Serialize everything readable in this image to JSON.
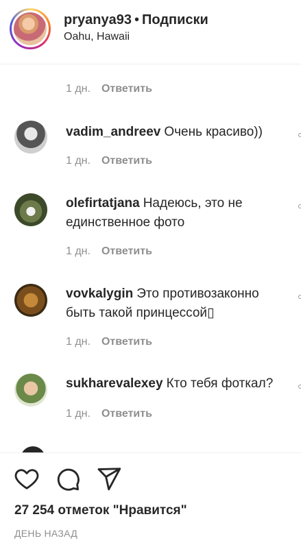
{
  "header": {
    "username": "pryanya93",
    "separator": "•",
    "follow_label": "Подписки",
    "location": "Oahu, Hawaii"
  },
  "comments": [
    {
      "user": "",
      "text": "",
      "time": "1 дн.",
      "reply": "Ответить"
    },
    {
      "user": "vadim_andreev",
      "text": "Очень красиво))",
      "time": "1 дн.",
      "reply": "Ответить"
    },
    {
      "user": "olefirtatjana",
      "text": "Надеюсь, это не единственное фото",
      "time": "1 дн.",
      "reply": "Ответить"
    },
    {
      "user": "vovkalygin",
      "text": "Это противозаконно быть такой принцессой▯",
      "time": "1 дн.",
      "reply": "Ответить"
    },
    {
      "user": "sukharevalexey",
      "text": "Кто тебя фоткал?",
      "time": "1 дн.",
      "reply": "Ответить"
    }
  ],
  "footer": {
    "likes": "27 254 отметок \"Нравится\"",
    "posted": "ДЕНЬ НАЗАД"
  },
  "icons": [
    "heart-icon",
    "comment-icon",
    "share-icon",
    "heart-outline-icon"
  ]
}
